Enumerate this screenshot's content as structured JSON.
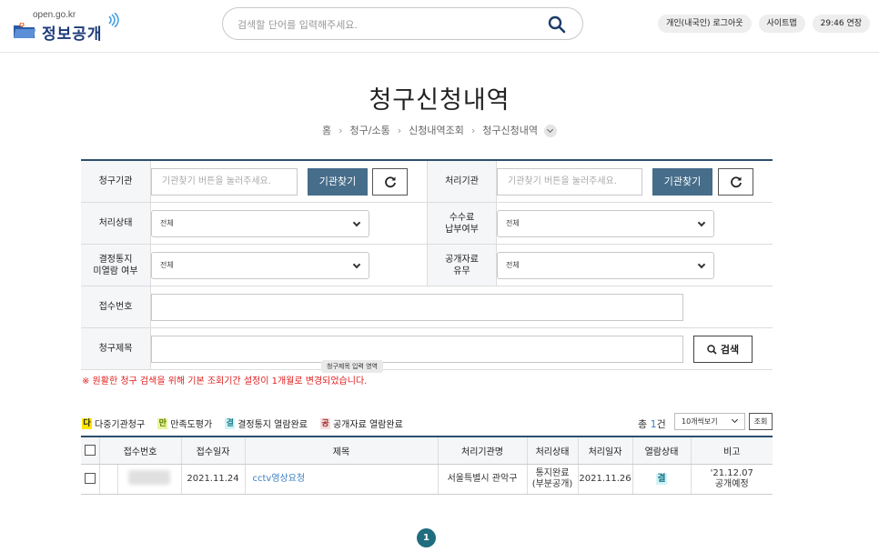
{
  "header": {
    "logo_small": "open.go.kr",
    "logo_main": "정보공개",
    "search_placeholder": "검색할 단어를 입력해주세요.",
    "buttons": [
      "개인(내국인) 로그아웃",
      "사이트맵",
      "29:46 연장"
    ]
  },
  "page": {
    "title": "청구신청내역",
    "breadcrumb": [
      "홈",
      "청구/소통",
      "신청내역조회",
      "청구신청내역"
    ]
  },
  "form": {
    "req_org_label": "청구기관",
    "req_org_placeholder": "기관찾기 버튼을 눌러주세요.",
    "proc_org_label": "처리기관",
    "proc_org_placeholder": "기관찾기 버튼을 눌러주세요.",
    "org_find_button": "기관찾기",
    "status_label": "처리상태",
    "status_value": "전체",
    "fee_label_1": "수수료",
    "fee_label_2": "납부여부",
    "fee_value": "전체",
    "notice_label_1": "결정통지",
    "notice_label_2": "미열람 여부",
    "notice_value": "전체",
    "public_label_1": "공개자료",
    "public_label_2": "유무",
    "public_value": "전체",
    "receipt_label": "접수번호",
    "receipt_value": "",
    "subject_label": "청구제목",
    "subject_value": "",
    "search_button": "검색",
    "tooltip": "청구제목 입력 영역",
    "notice": "※ 원활한 청구 검색을 위해 기본 조회기간 설정이 1개월로 변경되었습니다."
  },
  "legend": [
    {
      "mark": "다",
      "text": "다중기관청구",
      "bg": "#ffe500",
      "color": "#222"
    },
    {
      "mark": "만",
      "text": "만족도평가",
      "bg": "#e8f5a0",
      "color": "#5a7d00"
    },
    {
      "mark": "결",
      "text": "결정통지 열람완료",
      "bg": "#d2f3f7",
      "color": "#1a7a8a"
    },
    {
      "mark": "공",
      "text": "공개자료 열람완료",
      "bg": "#f5dede",
      "color": "#9c2a2a"
    }
  ],
  "list": {
    "total_prefix": "총",
    "total_count": "1",
    "total_suffix": "건",
    "per_page": "10개씩보기",
    "view_button": "조회",
    "columns": [
      "접수번호",
      "접수일자",
      "제목",
      "처리기관명",
      "처리상태",
      "처리일자",
      "열람상태",
      "비고"
    ],
    "rows": [
      {
        "receipt_no": "",
        "date": "2021.11.24",
        "title": "cctv영상요청",
        "org": "서울특별시 관악구",
        "status_1": "통지완료",
        "status_2": "(부분공개)",
        "proc_date": "2021.11.26",
        "view_state": "결",
        "note_1": "'21.12.07",
        "note_2": "공개예정"
      }
    ]
  },
  "pager": {
    "current": "1"
  }
}
